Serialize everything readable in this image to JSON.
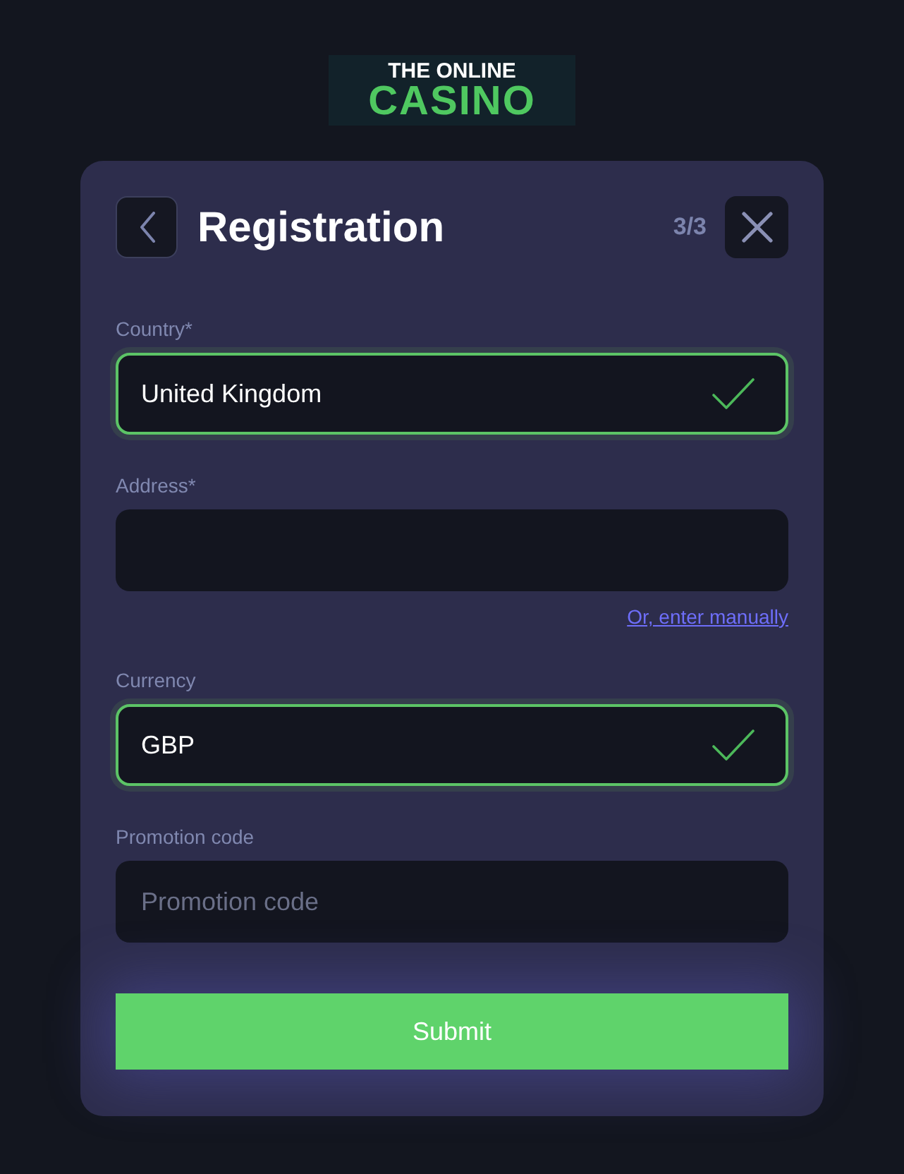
{
  "logo": {
    "line_1": "THE ONLINE",
    "line_2": "CASINO"
  },
  "header": {
    "title": "Registration",
    "step": "3/3"
  },
  "fields": [
    {
      "label": "Country*",
      "value": "United Kingdom",
      "valid": true
    },
    {
      "label": "Address*",
      "valid": false,
      "link": "Or, enter manually"
    },
    {
      "label": "Currency",
      "value": "GBP",
      "valid": true
    },
    {
      "label": "Promotion code",
      "placeholder": "Promotion code",
      "valid": false
    }
  ],
  "submit": "Submit"
}
